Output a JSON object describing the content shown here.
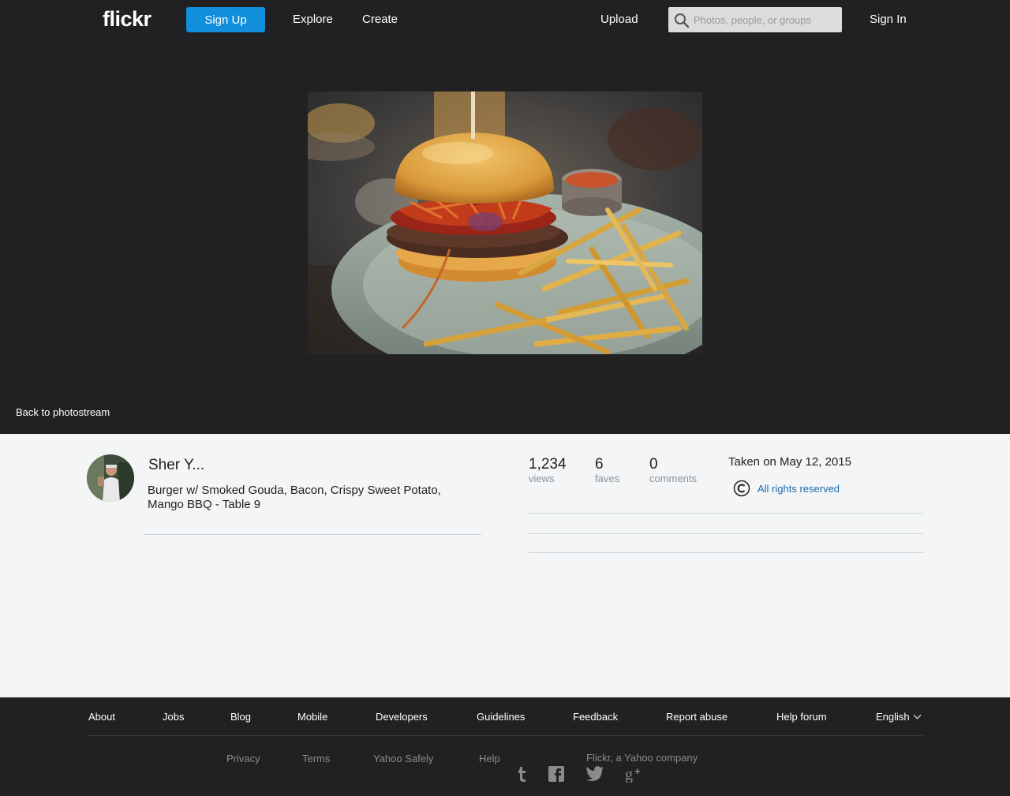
{
  "header": {
    "logo": "flickr",
    "signup_label": "Sign Up",
    "nav": [
      "Explore",
      "Create"
    ],
    "upload_label": "Upload",
    "search_placeholder": "Photos, people, or groups",
    "signin_label": "Sign In"
  },
  "photo": {
    "back_label": "Back to photostream"
  },
  "info": {
    "owner_name": "Sher Y...",
    "caption": "Burger w/ Smoked Gouda, Bacon, Crispy Sweet Potato, Mango BBQ - Table 9",
    "stats": [
      {
        "value": "1,234",
        "label": "views"
      },
      {
        "value": "6",
        "label": "faves"
      },
      {
        "value": "0",
        "label": "comments"
      }
    ],
    "taken": "Taken on May 12, 2015",
    "license": "All rights reserved"
  },
  "footer": {
    "links": [
      "About",
      "Jobs",
      "Blog",
      "Mobile",
      "Developers",
      "Guidelines",
      "Feedback",
      "Report abuse",
      "Help forum"
    ],
    "language": "English",
    "secondary": [
      "Privacy",
      "Terms",
      "Yahoo Safely",
      "Help"
    ],
    "company": "Flickr, a Yahoo company",
    "social_icons": [
      "tumblr-icon",
      "facebook-icon",
      "twitter-icon",
      "google-plus-icon"
    ]
  },
  "colors": {
    "accent": "#128fdc",
    "dark_bg": "#212124",
    "link": "#1c6bb0"
  }
}
